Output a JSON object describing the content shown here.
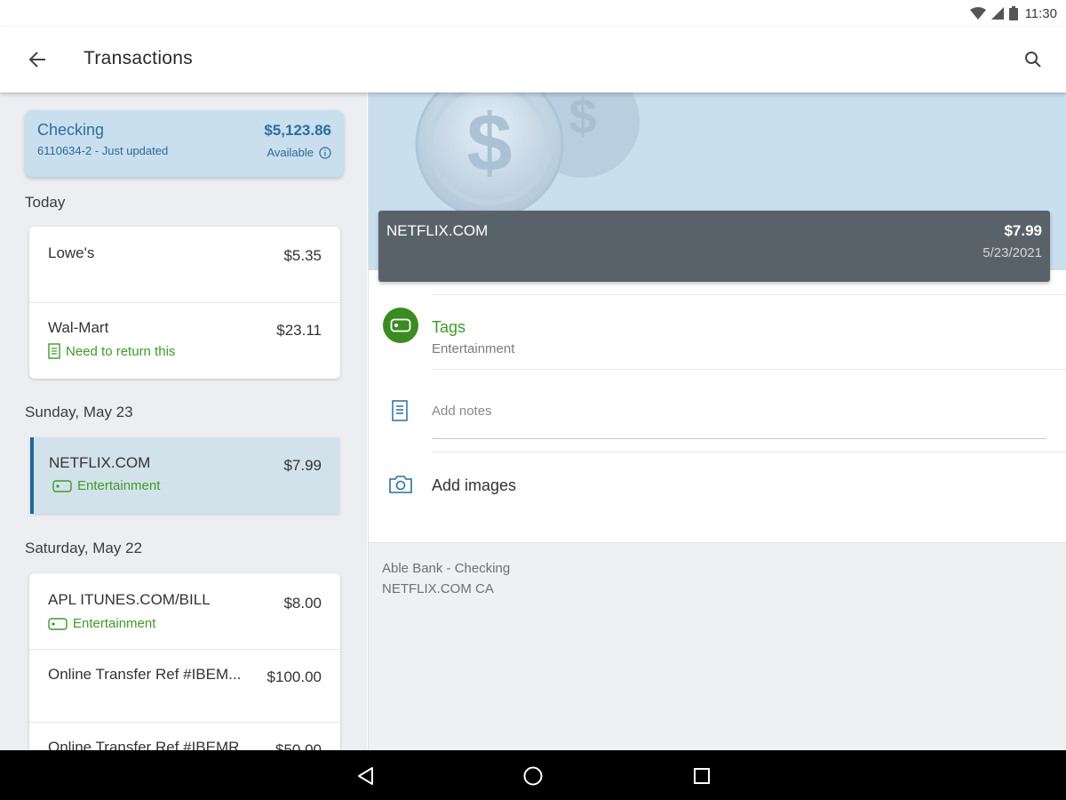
{
  "status_bar": {
    "time": "11:30",
    "icons": [
      "wifi-icon",
      "signal-icon",
      "battery-icon"
    ]
  },
  "app_bar": {
    "title": "Transactions",
    "back_icon": "arrow-left-icon",
    "search_icon": "search-icon"
  },
  "account": {
    "name": "Checking",
    "subtitle": "6110634-2 - Just updated",
    "balance": "$5,123.86",
    "balance_label": "Available",
    "info_icon": "info-icon"
  },
  "sections": [
    {
      "header": "Today",
      "transactions": [
        {
          "name": "Lowe's",
          "amount": "$5.35",
          "meta": ""
        },
        {
          "name": "Wal-Mart",
          "amount": "$23.11",
          "meta": "Need to return this",
          "meta_icon": "note-icon"
        }
      ]
    },
    {
      "header": "Sunday, May 23",
      "transactions": [
        {
          "name": "NETFLIX.COM",
          "amount": "$7.99",
          "meta": "Entertainment",
          "meta_icon": "tag-icon",
          "selected": true
        }
      ]
    },
    {
      "header": "Saturday, May 22",
      "transactions": [
        {
          "name": "APL ITUNES.COM/BILL",
          "amount": "$8.00",
          "meta": "Entertainment",
          "meta_icon": "tag-icon"
        },
        {
          "name": "Online Transfer Ref #IBEM...",
          "amount": "$100.00",
          "meta": ""
        },
        {
          "name": "Online Transfer Ref #IBEMR",
          "amount": "$50.00",
          "meta": ""
        }
      ]
    }
  ],
  "detail": {
    "merchant": "NETFLIX.COM",
    "amount": "$7.99",
    "date": "5/23/2021",
    "tags_label": "Tags",
    "tags_value": "Entertainment",
    "notes_placeholder": "Add notes",
    "images_label": "Add images",
    "footer_line1": "Able Bank - Checking",
    "footer_line2": "NETFLIX.COM CA"
  },
  "nav_bar": {
    "back_icon": "triangle-back-icon",
    "home_icon": "circle-home-icon",
    "recents_icon": "square-recents-icon"
  },
  "colors": {
    "accent_blue": "#2a6f9e",
    "tag_green": "#3f9a2a",
    "account_card_bg": "#c9dfee",
    "detail_bar_bg": "#5a6269",
    "selected_row_bg": "#d2e2ea"
  }
}
